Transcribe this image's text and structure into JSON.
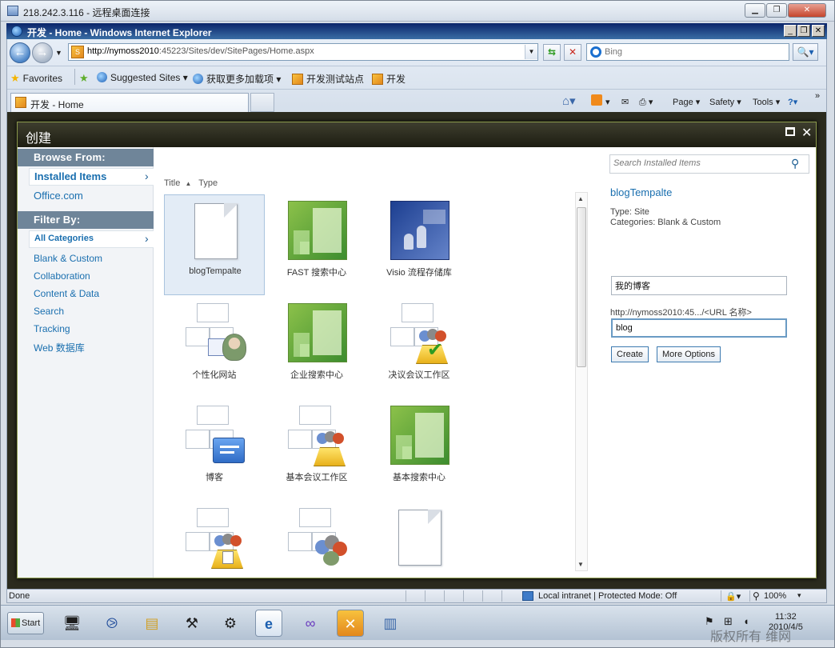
{
  "rdp": {
    "title": "218.242.3.116 - 远程桌面连接"
  },
  "ie": {
    "title": "开发 - Home - Windows Internet Explorer",
    "address_host": "http://nymoss2010",
    "address_rest": ":45223/Sites/dev/SitePages/Home.aspx",
    "search_placeholder": "Bing",
    "favorites": [
      {
        "label": "Favorites"
      },
      {
        "label": "Suggested Sites ▾"
      },
      {
        "label": "获取更多加载项 ▾"
      },
      {
        "label": "开发测试站点"
      },
      {
        "label": "开发"
      }
    ],
    "tab_title": "开发 - Home",
    "commands": {
      "page": "Page ▾",
      "safety": "Safety ▾",
      "tools": "Tools ▾"
    }
  },
  "dialog": {
    "title": "创建",
    "browse_header": "Browse From:",
    "browse_items": [
      {
        "label": "Installed Items"
      },
      {
        "label": "Office.com"
      }
    ],
    "filter_header": "Filter By:",
    "filter_selected": "All Categories",
    "filter_items": [
      {
        "label": "Blank & Custom"
      },
      {
        "label": "Collaboration"
      },
      {
        "label": "Content & Data"
      },
      {
        "label": "Search"
      },
      {
        "label": "Tracking"
      },
      {
        "label": "Web 数据库"
      }
    ],
    "list_header": {
      "title": "Title",
      "sort": "▲",
      "type": "Type"
    },
    "templates": [
      {
        "label": "blogTempalte",
        "icon": "document"
      },
      {
        "label": "FAST 搜索中心",
        "icon": "green-site"
      },
      {
        "label": "Visio 流程存储库",
        "icon": "blue-people"
      },
      {
        "label": "个性化网站",
        "icon": "org-person"
      },
      {
        "label": "企业搜索中心",
        "icon": "green-site"
      },
      {
        "label": "决议会议工作区",
        "icon": "org-check"
      },
      {
        "label": "博客",
        "icon": "org-chat"
      },
      {
        "label": "基本会议工作区",
        "icon": "org-meeting"
      },
      {
        "label": "基本搜索中心",
        "icon": "green-site"
      },
      {
        "label": "",
        "icon": "org-meeting-doc"
      },
      {
        "label": "",
        "icon": "org-people"
      },
      {
        "label": "",
        "icon": "document"
      }
    ],
    "side_search_placeholder": "Search Installed Items",
    "detail": {
      "title": "blogTempalte",
      "type_line": "Type: Site",
      "categories_line": "Categories: Blank & Custom",
      "name_value": "我的博客",
      "url_prefix": "http://nymoss2010:45.../<URL 名称>",
      "url_value": "blog",
      "create_label": "Create",
      "more_label": "More Options"
    }
  },
  "status": {
    "text": "Done",
    "zone": "Local intranet | Protected Mode: Off",
    "zoom": "100%"
  },
  "taskbar": {
    "start_label": "Start",
    "time": "11:32",
    "date": "2010/4/5"
  },
  "watermark": "版权所有 维网"
}
